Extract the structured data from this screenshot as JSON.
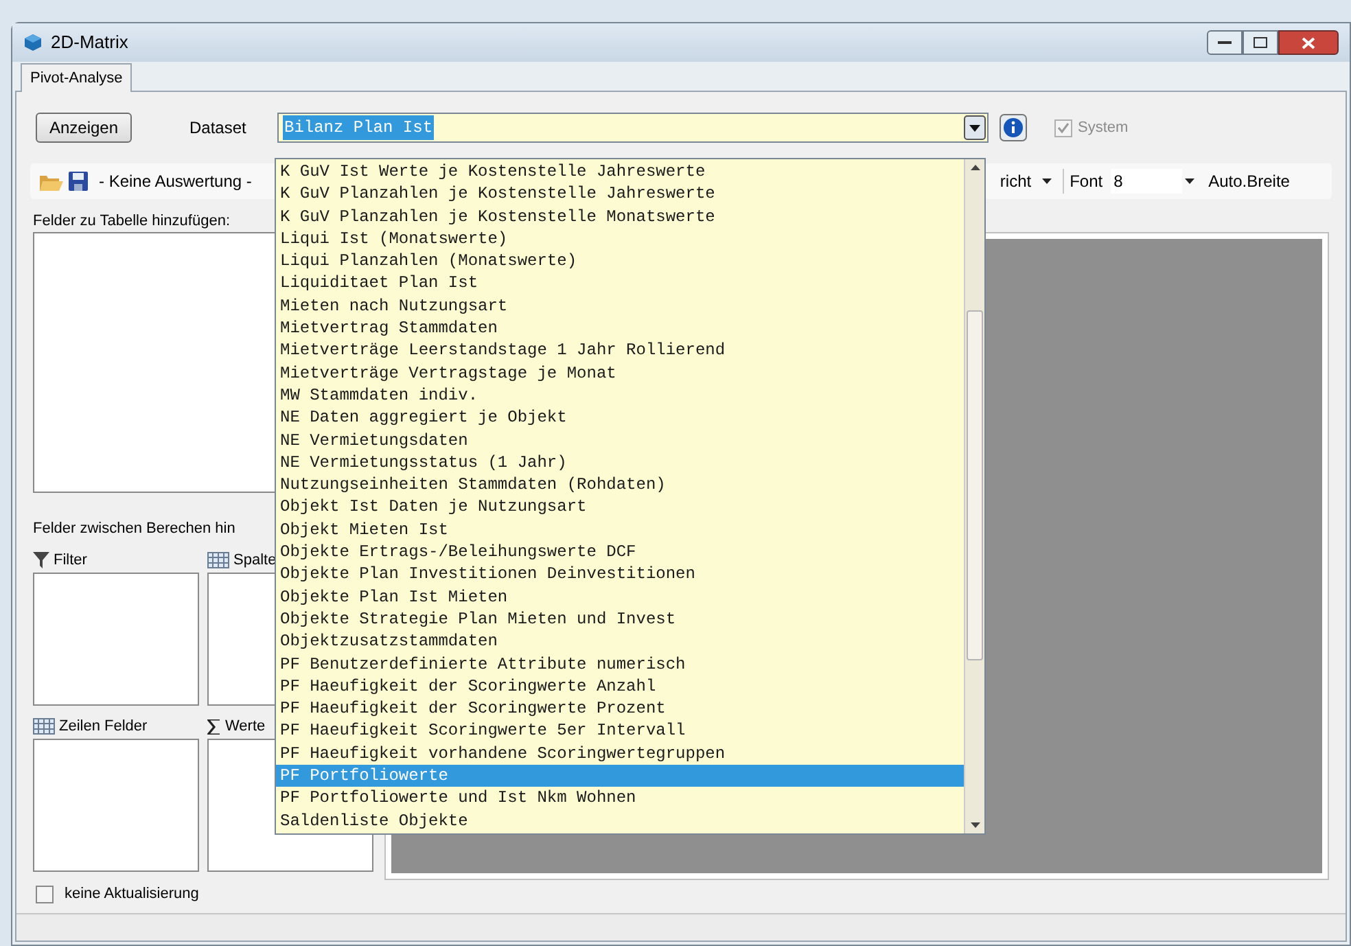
{
  "window": {
    "title": "2D-Matrix"
  },
  "tabs": [
    {
      "label": "Pivot-Analyse",
      "selected": true
    }
  ],
  "toolbar": {
    "show_button": "Anzeigen",
    "dataset_label": "Dataset",
    "dataset_value": "Bilanz Plan Ist",
    "system": {
      "label": "System",
      "checked": true,
      "disabled": true
    }
  },
  "toolbar2": {
    "report": "- Keine Auswertung -",
    "report_cut": "richt",
    "font_label": "Font",
    "font_value": "8",
    "auto_width": "Auto.Breite"
  },
  "left_panel": {
    "add_fields_label": "Felder zu Tabelle hinzufügen:",
    "drag_label": "Felder zwischen Berechen hin",
    "areas": [
      {
        "kind": "filter",
        "label": "Filter"
      },
      {
        "kind": "columns",
        "label": "Spalte"
      },
      {
        "kind": "rows",
        "label": "Zeilen Felder"
      },
      {
        "kind": "values",
        "label": "Werte"
      }
    ],
    "no_update": {
      "label": "keine Aktualisierung",
      "checked": false
    }
  },
  "dropdown": {
    "items": [
      {
        "label": "K GuV Ist Werte je Kostenstelle Jahreswerte",
        "selected": false
      },
      {
        "label": "K GuV Planzahlen je Kostenstelle Jahreswerte",
        "selected": false
      },
      {
        "label": "K GuV Planzahlen je Kostenstelle Monatswerte",
        "selected": false
      },
      {
        "label": "Liqui Ist (Monatswerte)",
        "selected": false
      },
      {
        "label": "Liqui Planzahlen (Monatswerte)",
        "selected": false
      },
      {
        "label": "Liquiditaet Plan Ist",
        "selected": false
      },
      {
        "label": "Mieten nach Nutzungsart",
        "selected": false
      },
      {
        "label": "Mietvertrag Stammdaten",
        "selected": false
      },
      {
        "label": "Mietverträge Leerstandstage 1 Jahr Rollierend",
        "selected": false
      },
      {
        "label": "Mietverträge Vertragstage je Monat",
        "selected": false
      },
      {
        "label": "MW Stammdaten indiv.",
        "selected": false
      },
      {
        "label": "NE Daten aggregiert je Objekt",
        "selected": false
      },
      {
        "label": "NE Vermietungsdaten",
        "selected": false
      },
      {
        "label": "NE Vermietungsstatus (1 Jahr)",
        "selected": false
      },
      {
        "label": "Nutzungseinheiten Stammdaten (Rohdaten)",
        "selected": false
      },
      {
        "label": "Objekt Ist Daten je Nutzungsart",
        "selected": false
      },
      {
        "label": "Objekt Mieten Ist",
        "selected": false
      },
      {
        "label": "Objekte Ertrags-/Beleihungswerte DCF",
        "selected": false
      },
      {
        "label": "Objekte Plan Investitionen Deinvestitionen",
        "selected": false
      },
      {
        "label": "Objekte Plan Ist Mieten",
        "selected": false
      },
      {
        "label": "Objekte Strategie Plan Mieten und Invest",
        "selected": false
      },
      {
        "label": "Objektzusatzstammdaten",
        "selected": false
      },
      {
        "label": "PF Benutzerdefinierte Attribute numerisch",
        "selected": false
      },
      {
        "label": "PF Haeufigkeit der Scoringwerte Anzahl",
        "selected": false
      },
      {
        "label": "PF Haeufigkeit der Scoringwerte Prozent",
        "selected": false
      },
      {
        "label": "PF Haeufigkeit Scoringwerte 5er Intervall",
        "selected": false
      },
      {
        "label": "PF Haeufigkeit vorhandene Scoringwertegruppen",
        "selected": false
      },
      {
        "label": "PF Portfoliowerte",
        "selected": true
      },
      {
        "label": "PF Portfoliowerte und Ist Nkm Wohnen",
        "selected": false
      },
      {
        "label": "Saldenliste Objekte",
        "selected": false
      }
    ]
  }
}
